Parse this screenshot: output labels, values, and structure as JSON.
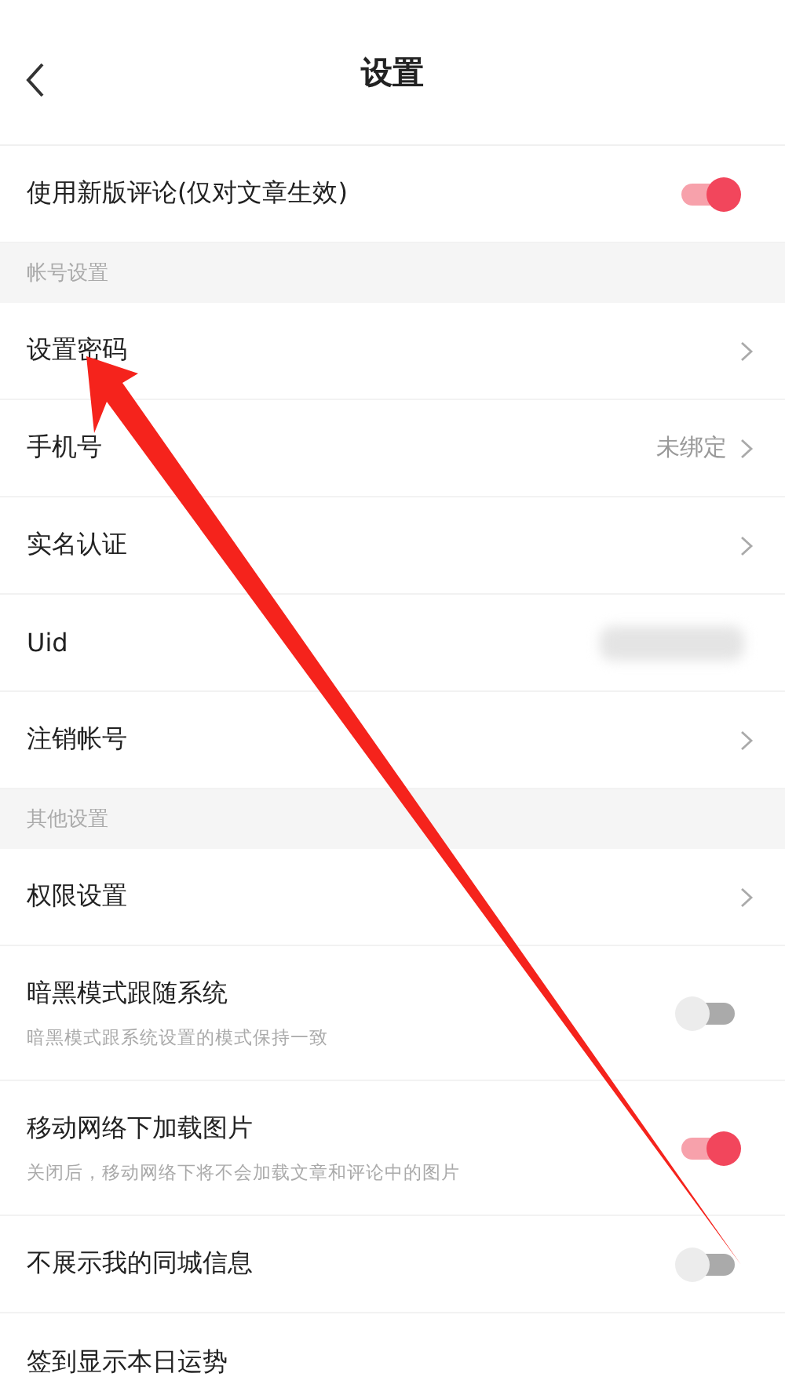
{
  "header": {
    "title": "设置"
  },
  "rows": [
    {
      "kind": "toggle",
      "label": "使用新版评论(仅对文章生效)",
      "on": true
    },
    {
      "kind": "section",
      "label": "帐号设置"
    },
    {
      "kind": "link",
      "label": "设置密码"
    },
    {
      "kind": "link",
      "label": "手机号",
      "value": "未绑定"
    },
    {
      "kind": "link",
      "label": "实名认证"
    },
    {
      "kind": "info",
      "label": "Uid",
      "redacted": true
    },
    {
      "kind": "link",
      "label": "注销帐号"
    },
    {
      "kind": "section",
      "label": "其他设置"
    },
    {
      "kind": "link",
      "label": "权限设置"
    },
    {
      "kind": "toggle",
      "label": "暗黑模式跟随系统",
      "description": "暗黑模式跟系统设置的模式保持一致",
      "on": false
    },
    {
      "kind": "toggle",
      "label": "移动网络下加载图片",
      "description": "关闭后，移动网络下将不会加载文章和评论中的图片",
      "on": true
    },
    {
      "kind": "toggle",
      "label": "不展示我的同城信息",
      "on": false
    },
    {
      "kind": "plain",
      "label": "签到显示本日运势"
    }
  ],
  "annotation": {
    "kind": "arrow"
  }
}
